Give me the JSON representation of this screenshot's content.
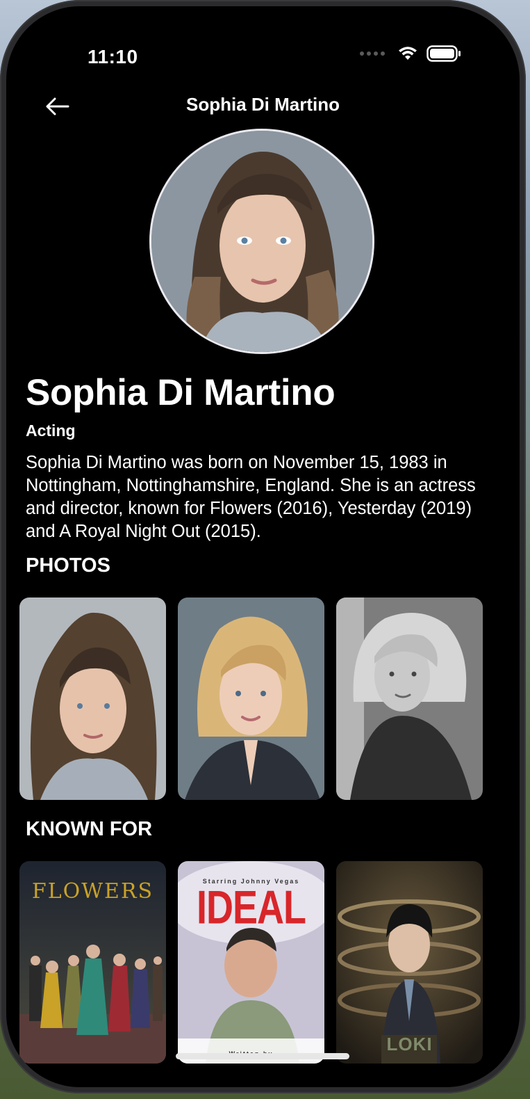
{
  "status_bar": {
    "time": "11:10"
  },
  "nav": {
    "title": "Sophia Di Martino",
    "back_icon": "arrow-left-icon"
  },
  "profile": {
    "name": "Sophia Di Martino",
    "department": "Acting",
    "biography": "Sophia Di Martino was born on November 15, 1983 in Nottingham, Nottinghamshire, England. She is an actress and director, known for Flowers (2016), Yesterday (2019) and A Royal Night Out (2015)."
  },
  "photos": {
    "title": "PHOTOS",
    "count": 3
  },
  "known_for": {
    "title": "KNOWN FOR",
    "posters": [
      {
        "title_text": "FLOWERS"
      },
      {
        "top_text": "Starring Johnny Vegas",
        "title_text": "IDEAL",
        "bottom_text": "Written by"
      },
      {
        "title_text": "LOKI"
      }
    ]
  },
  "colors": {
    "background": "#000000",
    "text": "#ffffff",
    "flowers_gold": "#c9a227",
    "ideal_red": "#d8262a"
  }
}
